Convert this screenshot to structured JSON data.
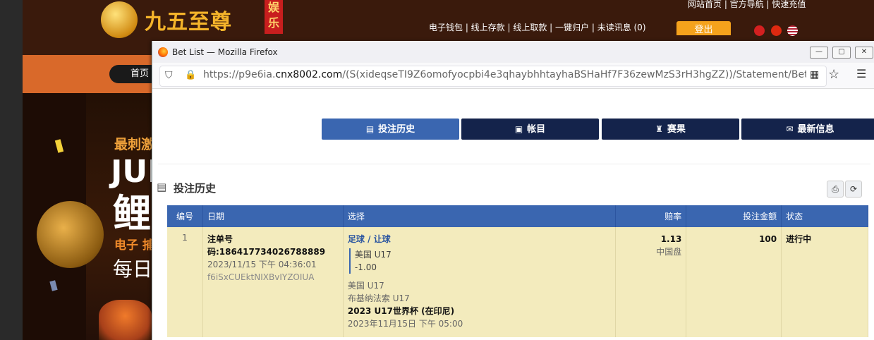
{
  "background_site": {
    "logo_text": "九五至尊",
    "logo_seal": "娱乐",
    "top_links": "网站首页 | 官方导航 | 快速充值",
    "account_links": "电子钱包 | 线上存款 | 线上取款 | 一键归户 | 未读讯息 (0)",
    "logout_label": "登出",
    "home_label": "首页",
    "hero_line1": "最刺激",
    "hero_line2": "JUI",
    "hero_line3": "鲤",
    "hero_line4": "电子 捕",
    "hero_line5": "每日"
  },
  "window": {
    "title": "Bet List — Mozilla Firefox",
    "url_host_prefix": "https://p9e6ia.",
    "url_host_domain": "cnx8002.com",
    "url_path": "/(S(xideqseTI9Z6omofyocpbi4e3qhaybhhtayhaBSHaHf7F36zewMzS3rH3hgZZ))/Statement/BetListApp"
  },
  "tabs": [
    {
      "label": "投注历史",
      "icon": "receipt-icon",
      "active": true
    },
    {
      "label": "帐目",
      "icon": "ledger-icon",
      "active": false
    },
    {
      "label": "赛果",
      "icon": "trophy-icon",
      "active": false
    },
    {
      "label": "最新信息",
      "icon": "mail-icon",
      "active": false
    }
  ],
  "section": {
    "title": "投注历史"
  },
  "table": {
    "headers": {
      "no": "编号",
      "date": "日期",
      "selection": "选择",
      "odds": "赔率",
      "amount": "投注金额",
      "status": "状态"
    },
    "rows": [
      {
        "no": "1",
        "ticket": "注单号码:186417734026788889",
        "datetime": "2023/11/15 下午 04:36:01",
        "ref": "f6iSxCUEktNIXBvIYZOIUA",
        "bet_type": "足球 / 让球",
        "pick_team": "美国 U17",
        "pick_handicap": "-1.00",
        "home": "美国 U17",
        "away": "布基纳法索 U17",
        "league": "2023 U17世界杯 (在印尼)",
        "match_time": "2023年11月15日 下午 05:00",
        "odds": "1.13",
        "odds_type": "中国盘",
        "amount": "100",
        "status": "进行中"
      }
    ]
  },
  "colors": {
    "tab_dark": "#14234b",
    "tab_active": "#3a66b0",
    "row_bg": "#f3ebbd"
  }
}
